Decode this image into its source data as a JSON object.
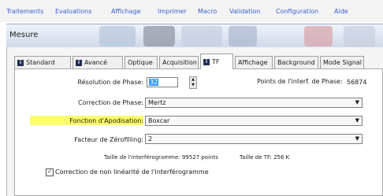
{
  "menu": [
    "Traitements",
    "Evaluations",
    "Affichage",
    "Imprimer",
    "Macro",
    "Validation",
    "Configuration",
    "Aide"
  ],
  "window": {
    "title": "Mesure"
  },
  "tabs": [
    {
      "label": "Standard",
      "badge": "i"
    },
    {
      "label": "Avancé",
      "badge": "i"
    },
    {
      "label": "Optique",
      "badge": ""
    },
    {
      "label": "Acquisition",
      "badge": ""
    },
    {
      "label": "TF",
      "badge": "i"
    },
    {
      "label": "Affichage",
      "badge": ""
    },
    {
      "label": "Background",
      "badge": ""
    },
    {
      "label": "Mode Signal",
      "badge": ""
    }
  ],
  "fields": {
    "phase_resolution": {
      "label": "Résolution de Phase:",
      "value": "32"
    },
    "phase_points": {
      "label": "Points de l'interf. de Phase:",
      "value": "56874"
    },
    "phase_correction": {
      "label": "Correction de Phase:",
      "value": "Mertz"
    },
    "apodization": {
      "label": "Fonction d'Apodisation:",
      "value": "Boxcar"
    },
    "zerofilling": {
      "label": "Facteur de Zérofilling:",
      "value": "2"
    }
  },
  "info": {
    "interferogram_size": "Taille de l'interférogramme: 99527 points",
    "tf_size": "Taille de TF: 256 K"
  },
  "nonlinearity": {
    "label": "Correction de non linéarité de l'interférogramme",
    "checked": true
  },
  "colors": {
    "menu_text": "#3a5fcf",
    "highlight": "#fdfc6a",
    "selection": "#3399ff"
  }
}
